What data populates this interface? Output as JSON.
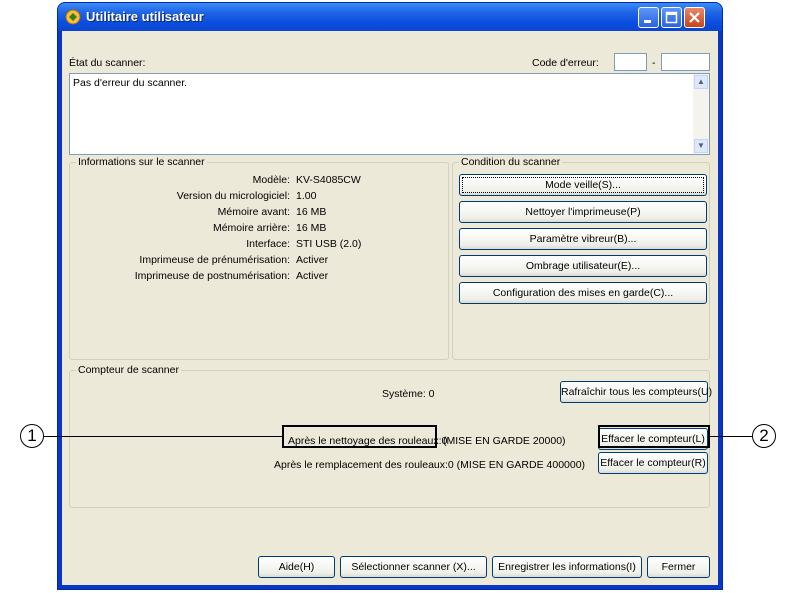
{
  "window": {
    "title": "Utilitaire utilisateur"
  },
  "status": {
    "label": "État du scanner:",
    "error_code_label": "Code d'erreur:",
    "error_separator": "-",
    "message": "Pas d'erreur du scanner."
  },
  "info": {
    "title": "Informations sur le scanner",
    "rows": [
      {
        "label": "Modèle:",
        "value": "KV-S4085CW"
      },
      {
        "label": "Version du micrologiciel:",
        "value": "1.00"
      },
      {
        "label": "Mémoire avant:",
        "value": "16 MB"
      },
      {
        "label": "Mémoire arrière:",
        "value": "16 MB"
      },
      {
        "label": "Interface:",
        "value": "STI USB (2.0)"
      },
      {
        "label": "Imprimeuse de prénumérisation:",
        "value": "Activer"
      },
      {
        "label": "Imprimeuse de postnumérisation:",
        "value": "Activer"
      }
    ]
  },
  "condition": {
    "title": "Condition du scanner",
    "buttons": [
      "Mode veille(S)...",
      "Nettoyer l'imprimeuse(P)",
      "Paramètre vibreur(B)...",
      "Ombrage utilisateur(E)...",
      "Configuration des mises en garde(C)..."
    ]
  },
  "counter": {
    "title": "Compteur de scanner",
    "system": "Système: 0",
    "refresh_button": "Rafraîchir tous les compteurs(U)",
    "after_cleaning": "Après le nettoyage des rouleaux:0",
    "after_cleaning_warning": "(MISE EN GARDE 20000)",
    "after_replacement": "Après le remplacement des rouleaux:0 (MISE EN GARDE 400000)",
    "clear_l": "Effacer le compteur(L)",
    "clear_r": "Effacer le compteur(R)"
  },
  "footer": {
    "help": "Aide(H)",
    "select_scanner": "Sélectionner scanner (X)...",
    "save_info": "Enregistrer les informations(I)",
    "close": "Fermer"
  },
  "callouts": {
    "one": "1",
    "two": "2"
  },
  "colors": {
    "titlebar": "#0a4ee0",
    "face": "#ece9d8",
    "border": "#003c74"
  }
}
